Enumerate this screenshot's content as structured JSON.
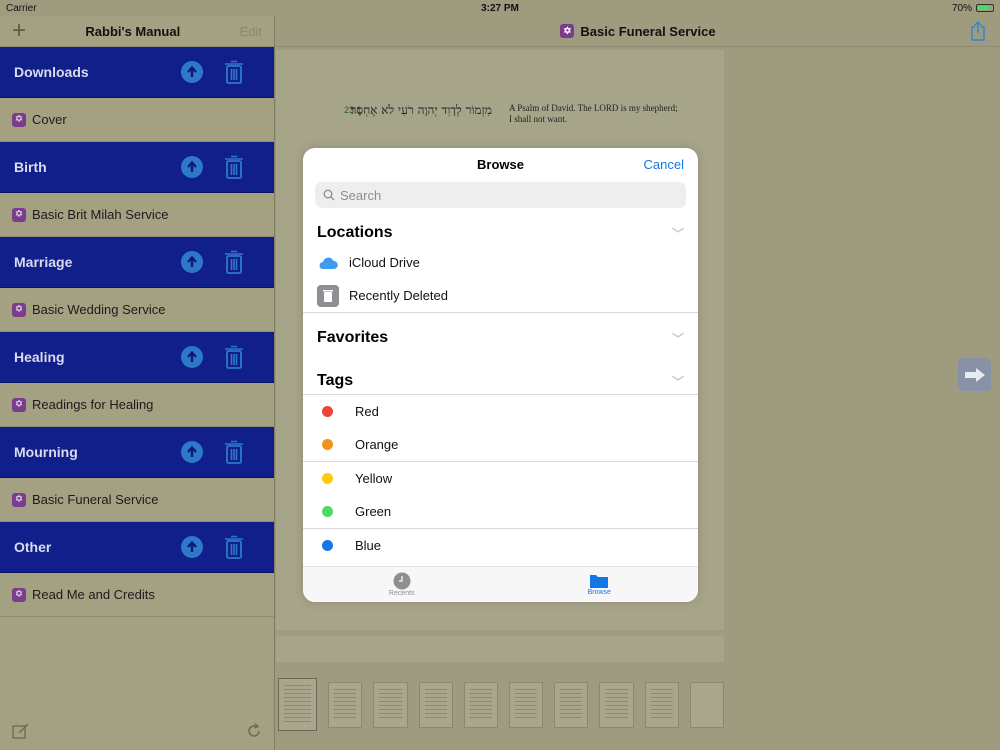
{
  "status": {
    "carrier": "Carrier",
    "time": "3:27 PM",
    "battery": "70%"
  },
  "sidebar": {
    "title": "Rabbi's Manual",
    "add": "+",
    "edit": "Edit",
    "sections": [
      {
        "label": "Downloads",
        "item": "Cover"
      },
      {
        "label": "Birth",
        "item": "Basic Brit Milah Service"
      },
      {
        "label": "Marriage",
        "item": "Basic Wedding Service"
      },
      {
        "label": "Healing",
        "item": "Readings for Healing"
      },
      {
        "label": "Mourning",
        "item": "Basic Funeral Service"
      },
      {
        "label": "Other",
        "item": "Read Me and Credits"
      }
    ]
  },
  "main": {
    "title": "Basic Funeral Service",
    "verse_ref": "23:1",
    "hebrew": "מִזְמוֹר לְדָוִד יְהוָה רֹעִי לֹא אֶחְסָר׃",
    "english": "A Psalm of David. The LORD is my shepherd; I shall not want."
  },
  "modal": {
    "title": "Browse",
    "cancel": "Cancel",
    "search_placeholder": "Search",
    "locations_title": "Locations",
    "locations": [
      "iCloud Drive",
      "Recently Deleted"
    ],
    "favorites_title": "Favorites",
    "tags_title": "Tags",
    "tags": [
      {
        "name": "Red",
        "color": "#f0433a"
      },
      {
        "name": "Orange",
        "color": "#f5911e"
      },
      {
        "name": "Yellow",
        "color": "#fdcb0e"
      },
      {
        "name": "Green",
        "color": "#4cd964"
      },
      {
        "name": "Blue",
        "color": "#1477e8"
      }
    ],
    "tabs": {
      "recents": "Recents",
      "browse": "Browse"
    }
  }
}
